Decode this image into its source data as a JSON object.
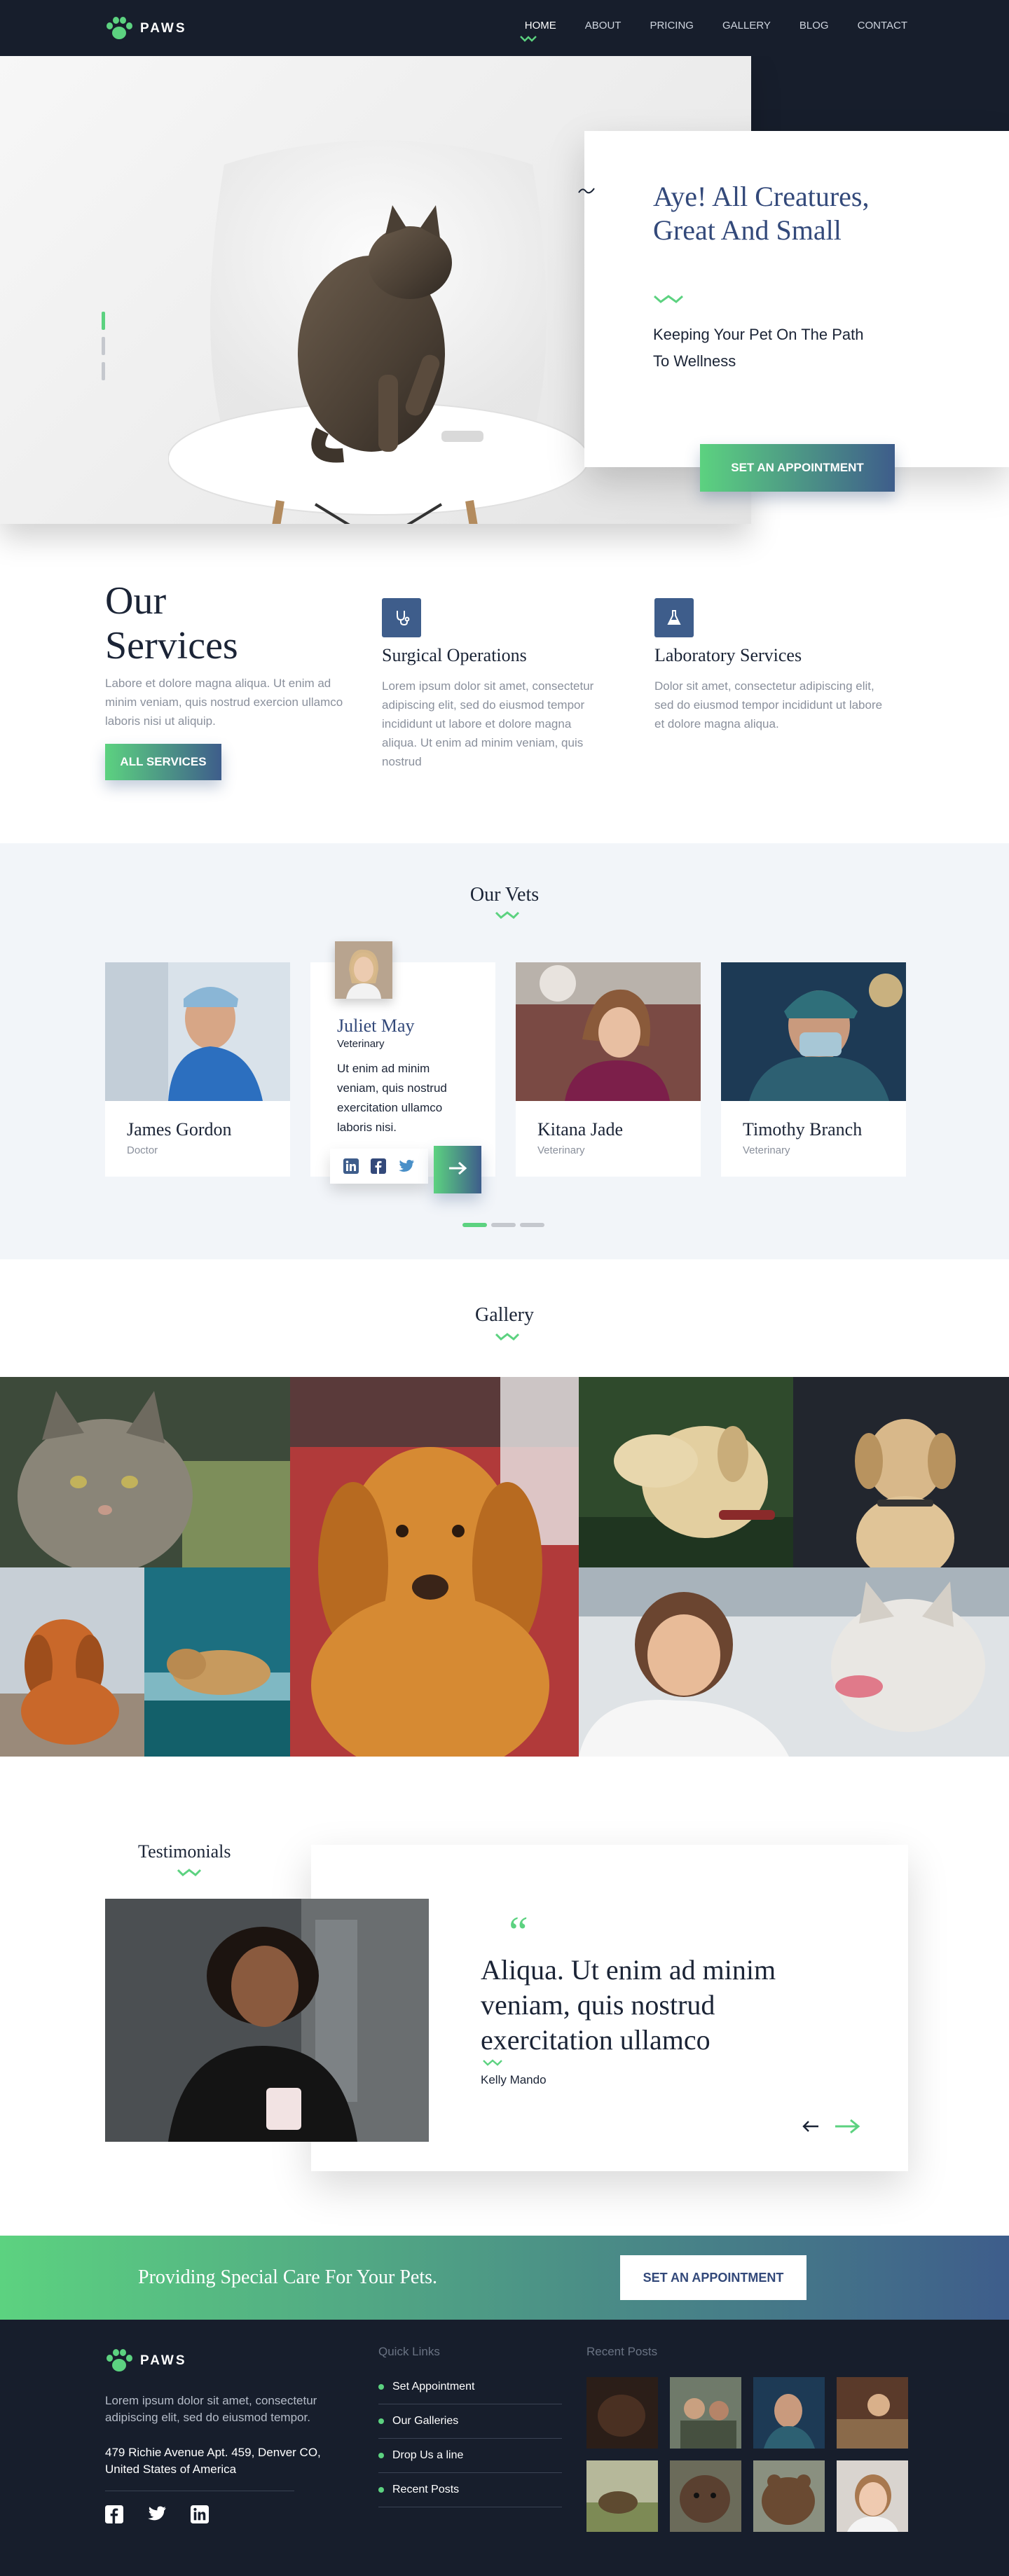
{
  "nav": {
    "brand": "PAWS",
    "items": [
      {
        "label": "HOME",
        "active": true
      },
      {
        "label": "ABOUT"
      },
      {
        "label": "PRICING"
      },
      {
        "label": "GALLERY"
      },
      {
        "label": "BLOG"
      },
      {
        "label": "CONTACT"
      }
    ]
  },
  "hero": {
    "title": "Aye! All Creatures, Great And Small",
    "subtitle": "Keeping Your Pet On The Path To Wellness",
    "cta": "SET AN APPOINTMENT"
  },
  "services": {
    "title_line1": "Our",
    "title_line2": "Services",
    "description": "Labore et dolore magna aliqua. Ut enim ad minim veniam, quis nostrud exercion ullamco laboris nisi ut aliquip.",
    "button": "ALL SERVICES",
    "items": [
      {
        "name": "Surgical Operations",
        "icon": "stethoscope-icon",
        "text": "Lorem ipsum dolor sit amet, consectetur adipiscing elit, sed do eiusmod tempor incididunt ut labore et dolore magna aliqua. Ut enim ad minim veniam, quis nostrud"
      },
      {
        "name": "Laboratory Services",
        "icon": "flask-icon",
        "text": "Dolor sit amet, consectetur adipiscing elit, sed do eiusmod tempor incididunt ut labore et dolore magna aliqua."
      }
    ]
  },
  "vets": {
    "title": "Our Vets",
    "members": [
      {
        "name": "James Gordon",
        "role": "Doctor"
      },
      {
        "name": "Juliet May",
        "role": "Veterinary",
        "bio": "Ut enim ad minim veniam, quis nostrud exercitation ullamco laboris nisi."
      },
      {
        "name": "Kitana Jade",
        "role": "Veterinary"
      },
      {
        "name": "Timothy Branch",
        "role": "Veterinary"
      }
    ]
  },
  "gallery": {
    "title": "Gallery"
  },
  "testimonials": {
    "title": "Testimonials",
    "quote_mark": "“",
    "quote": "Aliqua. Ut enim ad minim veniam, quis nostrud exercitation ullamco",
    "author": "Kelly Mando"
  },
  "cta_band": {
    "text": "Providing Special Care For Your Pets.",
    "button": "SET AN APPOINTMENT"
  },
  "footer": {
    "brand": "PAWS",
    "description": "Lorem ipsum dolor sit amet, consectetur adipiscing elit, sed do eiusmod tempor.",
    "address": "479 Richie Avenue Apt. 459, Denver CO, United States of America",
    "quick_links_title": "Quick Links",
    "quick_links": [
      "Set Appointment",
      "Our Galleries",
      "Drop Us a line",
      "Recent Posts"
    ],
    "recent_posts_title": "Recent Posts"
  },
  "colors": {
    "navy": "#171e2c",
    "accent_green": "#5cd280",
    "accent_blue": "#3e5d8b",
    "heading_blue": "#33497a"
  }
}
